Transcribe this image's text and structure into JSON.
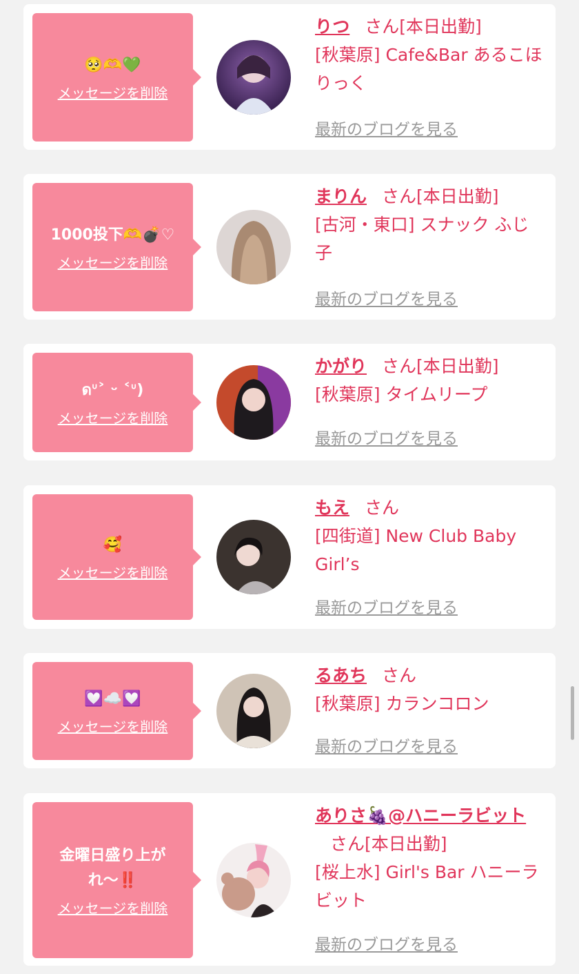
{
  "cards": [
    {
      "message": "🥺🫶💚",
      "delete_label": "メッセージを削除",
      "name": "りつ",
      "honorific": "さん",
      "status": "[本日出勤]",
      "shop": "[秋葉原] Cafe&Bar あるこほりっく",
      "blog_label": "最新のブログを見る"
    },
    {
      "message": "1000投下🫶💣♡",
      "delete_label": "メッセージを削除",
      "name": "まりん",
      "honorific": "さん",
      "status": "[本日出勤]",
      "shop": "[古河・東口] スナック ふじ子",
      "blog_label": "最新のブログを見る"
    },
    {
      "message": "ดᐡ˃ ᵕ ˂ᐡ)",
      "delete_label": "メッセージを削除",
      "name": "かがり",
      "honorific": "さん",
      "status": "[本日出勤]",
      "shop": "[秋葉原] タイムリープ",
      "blog_label": "最新のブログを見る"
    },
    {
      "message": "🥰",
      "delete_label": "メッセージを削除",
      "name": "もえ",
      "honorific": "さん",
      "status": "",
      "shop": "[四街道] New Club Baby Girl’s",
      "blog_label": "最新のブログを見る"
    },
    {
      "message": "💟☁️💟",
      "delete_label": "メッセージを削除",
      "name": "るあち",
      "honorific": "さん",
      "status": "",
      "shop": "[秋葉原] カランコロン",
      "blog_label": "最新のブログを見る"
    },
    {
      "message": "金曜日盛り上がれ〜‼️",
      "delete_label": "メッセージを削除",
      "name": "ありさ🍇@ハニーラビット",
      "honorific": "さん",
      "status": "[本日出勤]",
      "shop": "[桜上水] Girl's Bar ハニーラビット",
      "blog_label": "最新のブログを見る"
    }
  ]
}
